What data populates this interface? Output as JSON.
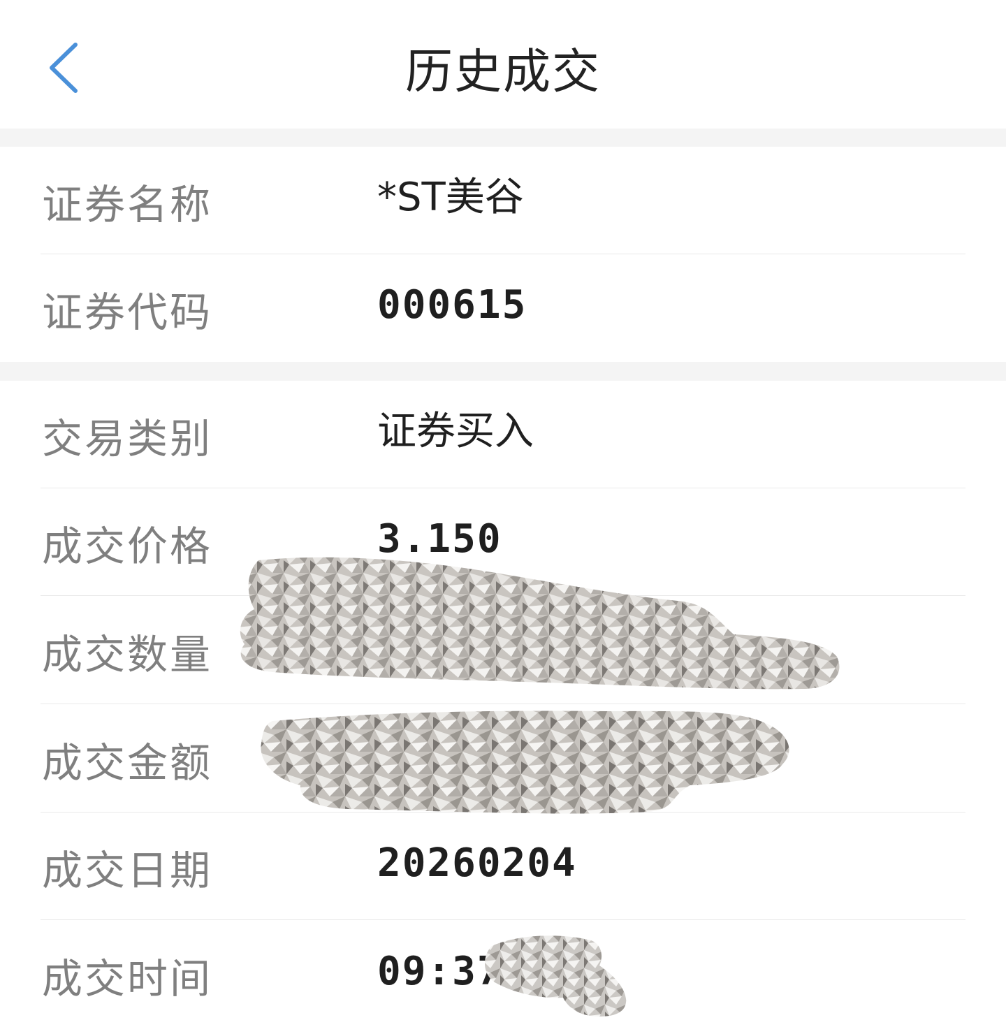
{
  "header": {
    "title": "历史成交",
    "back_icon": "chevron-left-icon",
    "accent_color": "#4a90d9"
  },
  "security": {
    "rows": [
      {
        "label": "证券名称",
        "value": "*ST美谷"
      },
      {
        "label": "证券代码",
        "value": "000615"
      }
    ]
  },
  "trade": {
    "rows": [
      {
        "label": "交易类别",
        "value": "证券买入"
      },
      {
        "label": "成交价格",
        "value": "3.150"
      },
      {
        "label": "成交数量",
        "value": ""
      },
      {
        "label": "成交金额",
        "value": ""
      },
      {
        "label": "成交日期",
        "value": "20260204"
      },
      {
        "label": "成交时间",
        "value": "09:37"
      }
    ]
  }
}
